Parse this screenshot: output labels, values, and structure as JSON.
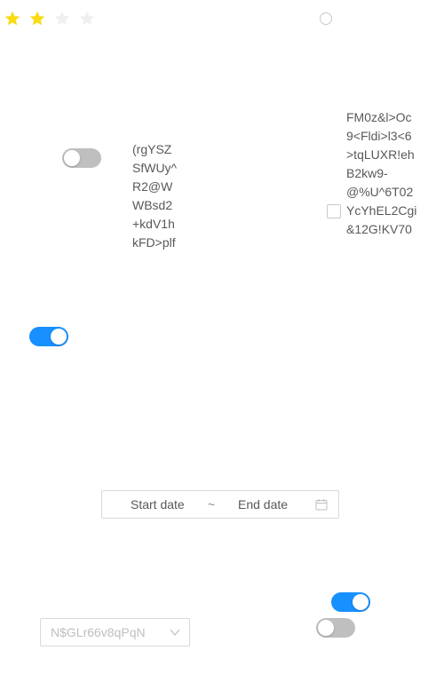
{
  "rating": {
    "value": 2,
    "max": 4,
    "filled_color": "#fadb14",
    "empty_color": "#f0f0f0"
  },
  "text_block_left": "(rgYSZ\nSfWUy^\nR2@W\nWBsd2\n+kdV1h\nkFD>plf",
  "text_block_right": "FM0z&l>Oc\n9<Fldi>l3<6\n>tqLUXR!eh\nB2kw9-\n@%U^6T02\nYcYhEL2Cgi\n&12G!KV70",
  "switches": {
    "switch_1": false,
    "switch_2": true,
    "switch_3": true,
    "switch_4": false
  },
  "radio": {
    "checked": false
  },
  "checkbox": {
    "checked": false
  },
  "date_range": {
    "start_placeholder": "Start date",
    "separator": "~",
    "end_placeholder": "End date"
  },
  "select": {
    "placeholder": "N$GLr66v8qPqN"
  },
  "colors": {
    "primary": "#1890ff",
    "switch_off": "#bfbfbf",
    "border": "#d9d9d9",
    "text": "#595959",
    "placeholder": "#bfbfbf"
  }
}
